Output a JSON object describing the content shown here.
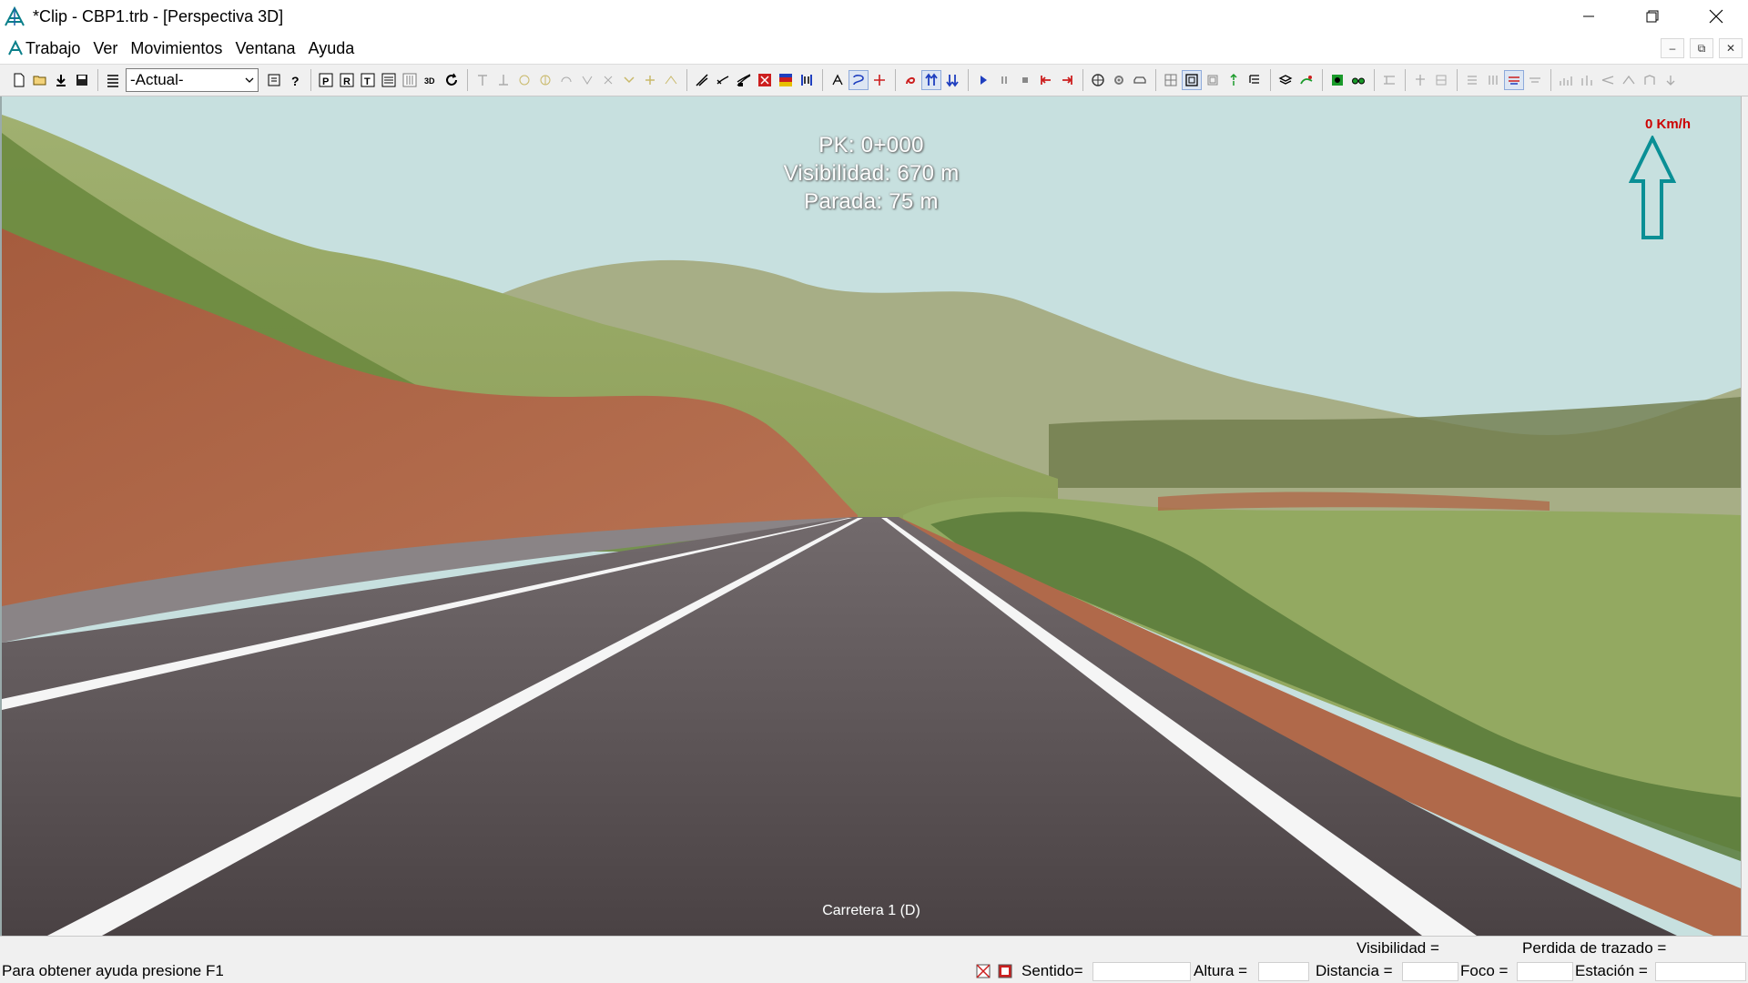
{
  "window": {
    "title": "*Clip - CBP1.trb - [Perspectiva 3D]",
    "controls": [
      "minimize",
      "restore",
      "close"
    ]
  },
  "menu": {
    "items": [
      "Trabajo",
      "Ver",
      "Movimientos",
      "Ventana",
      "Ayuda"
    ]
  },
  "toolbar": {
    "view_select_value": "-Actual-",
    "colors": {
      "blue": "#1f3fbf",
      "red": "#cc1f1f",
      "green": "#1a9a2a",
      "yellow": "#e8c000"
    }
  },
  "viewport": {
    "pk": "PK: 0+000",
    "visibility": "Visibilidad: 670 m",
    "stop": "Parada: 75 m",
    "speed": "0 Km/h",
    "road_label": "Carretera 1 (D)",
    "colors": {
      "sky": "#c7e0df",
      "asphalt": "#5a5053",
      "earth": "#b0694a",
      "grass": "#8ea45a",
      "north_arrow": "#0a8f95"
    }
  },
  "status": {
    "help_text": "Para obtener ayuda presione F1",
    "visibility_label": "Visibilidad =",
    "trace_loss_label": "Perdida de trazado =",
    "direction_label": "Sentido=",
    "height_label": "Altura =",
    "distance_label": "Distancia =",
    "focus_label": "Foco =",
    "station_label": "Estación ="
  }
}
